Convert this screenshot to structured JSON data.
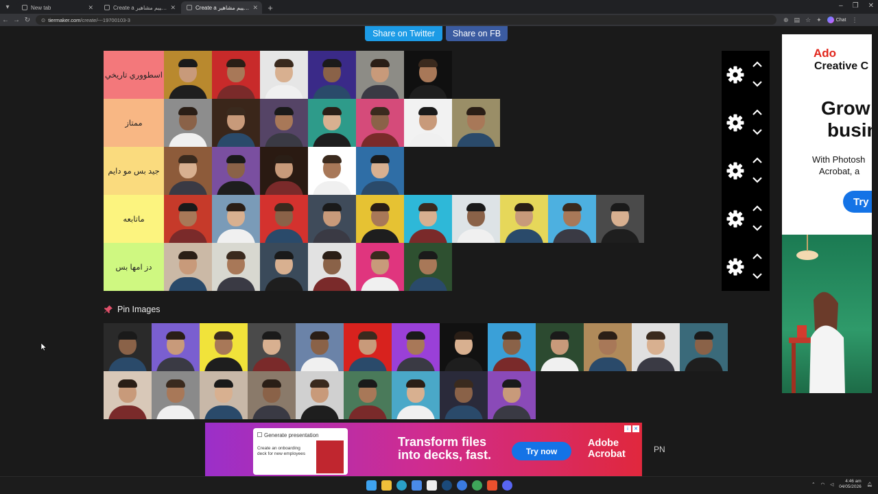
{
  "browser": {
    "tabs": [
      {
        "title": "New tab",
        "active": false
      },
      {
        "title": "Create a تقييم مشاهير Tier List - Ti",
        "active": false
      },
      {
        "title": "Create a تقييم مشاهير Tier List - Ti",
        "active": true
      }
    ],
    "url_host": "tiermaker.com",
    "url_path": "/create/---19700103-3",
    "chat_label": "Chat"
  },
  "share": {
    "twitter_label": "Share on Twitter",
    "fb_label": "Share on FB"
  },
  "tiers": [
    {
      "label": "اسطووري تاريخي",
      "color": "#f3787b",
      "items": [
        "#b9892e",
        "#c82a2a",
        "#e6e6e6",
        "#3a2a88",
        "#8d8c86",
        "#101010"
      ]
    },
    {
      "label": "ممتاز",
      "color": "#f8b784",
      "items": [
        "#8d8d8d",
        "#3a261a",
        "#554466",
        "#2e9b8a",
        "#d54b7a",
        "#f2f2f2",
        "#9a8e67"
      ]
    },
    {
      "label": "جيد بس مو دايم",
      "color": "#fadb7e",
      "items": [
        "#8d5b3a",
        "#7a4fa0",
        "#2a1a12",
        "#ffffff",
        "#2f6ea6"
      ]
    },
    {
      "label": "ماتابعه",
      "color": "#fcf47f",
      "items": [
        "#c63a2a",
        "#7a9bb8",
        "#d4322e",
        "#3f4b5a",
        "#e6c233",
        "#2eb8d8",
        "#dde3e6",
        "#e6d75a",
        "#4db0e0",
        "#4a4a4a"
      ]
    },
    {
      "label": "دز امها بس",
      "color": "#cff881",
      "items": [
        "#cbb9a6",
        "#d8d8d0",
        "#3a4a5a",
        "#e2e2e2",
        "#e0357e",
        "#2e5030"
      ]
    }
  ],
  "pin": {
    "title": "Pin Images",
    "items": [
      "#2a2a2a",
      "#7a5fd0",
      "#f1e33a",
      "#4a4a4a",
      "#6b83a8",
      "#d8221e",
      "#9a40d8",
      "#111111",
      "#3aa0d8",
      "#2c4a30",
      "#b08a5a",
      "#e0e0e0",
      "#3a6a7a",
      "#d8c8b8",
      "#8a8a8a",
      "#c8b8a8",
      "#8a7a6a",
      "#d0d0d0",
      "#4a7a5a",
      "#4aa8c8",
      "#2a2a3a",
      "#8a4ab8"
    ]
  },
  "side_ad": {
    "brand_line1": "Ado",
    "brand_line2": "Creative C",
    "headline1": "Grow",
    "headline2": "busin",
    "sub1": "With Photosh",
    "sub2": "Acrobat, a",
    "cta": "Try"
  },
  "bottom_ad": {
    "card_title": "Generate presentation",
    "card_text": "Create an onboarding deck for new employees",
    "headline1": "Transform files",
    "headline2": "into decks, fast.",
    "cta": "Try now",
    "brand1": "Adobe",
    "brand2": "Acrobat"
  },
  "pn_label": "PN",
  "taskbar": {
    "time": "4:46 am",
    "date": "04/05/2026"
  }
}
